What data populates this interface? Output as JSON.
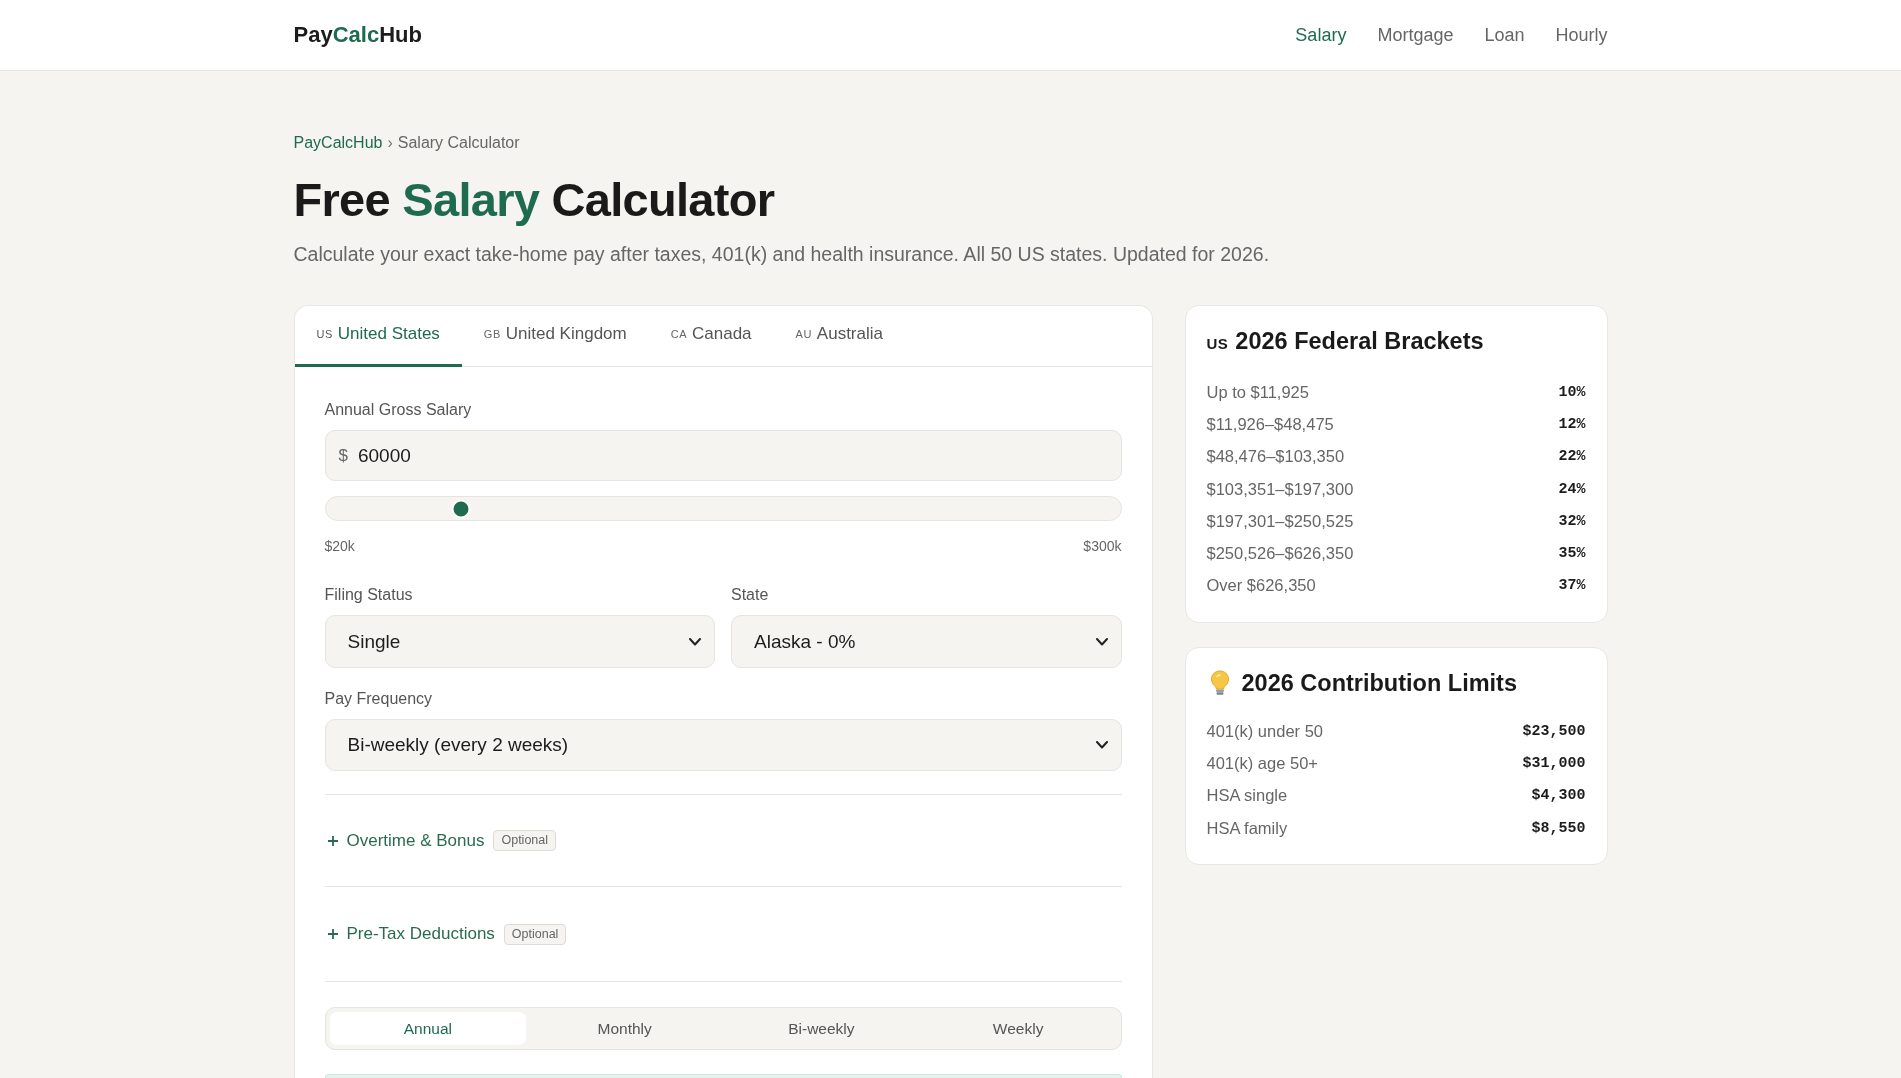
{
  "header": {
    "logo": [
      {
        "text": "Pay",
        "accent": false
      },
      {
        "text": "Calc",
        "accent": true
      },
      {
        "text": "Hub",
        "accent": false
      }
    ],
    "nav": [
      {
        "label": "Salary",
        "selected": true
      },
      {
        "label": "Mortgage",
        "selected": false
      },
      {
        "label": "Loan",
        "selected": false
      },
      {
        "label": "Hourly",
        "selected": false
      }
    ]
  },
  "breadcrumb": {
    "items": [
      {
        "text": "PayCalcHub",
        "kind": "link"
      },
      {
        "text": "Salary Calculator",
        "kind": "current"
      }
    ],
    "separator": "›"
  },
  "title": [
    {
      "text": "Free ",
      "accent": false
    },
    {
      "text": "Salary",
      "accent": true
    },
    {
      "text": " Calculator",
      "accent": false
    }
  ],
  "subtitle": "Calculate your exact take-home pay after taxes, 401(k) and health insurance. All 50 US states. Updated for 2026.",
  "calculator": {
    "tabs": [
      {
        "flag": "US",
        "label": "United States",
        "selected": true
      },
      {
        "flag": "GB",
        "label": "United Kingdom",
        "selected": false
      },
      {
        "flag": "CA",
        "label": "Canada",
        "selected": false
      },
      {
        "flag": "AU",
        "label": "Australia",
        "selected": false
      }
    ],
    "salary": {
      "label": "Annual Gross Salary",
      "prefix": "$",
      "value": "60000",
      "slider": {
        "level": 0.17
      },
      "min_label": "$20k",
      "max_label": "$300k"
    },
    "filing_status": {
      "label": "Filing Status",
      "value": "Single"
    },
    "state": {
      "label": "State",
      "value": "Alaska - 0%"
    },
    "pay_frequency": {
      "label": "Pay Frequency",
      "value": "Bi-weekly (every 2 weeks)"
    },
    "sections": [
      {
        "title": "Overtime & Bonus",
        "badge": "Optional",
        "expanded": false
      },
      {
        "title": "Pre-Tax Deductions",
        "badge": "Optional",
        "expanded": false
      }
    ],
    "periods": [
      {
        "label": "Annual",
        "selected": true
      },
      {
        "label": "Monthly",
        "selected": false
      },
      {
        "label": "Bi-weekly",
        "selected": false
      },
      {
        "label": "Weekly",
        "selected": false
      }
    ]
  },
  "brackets_card": {
    "flag": "US",
    "title": "2026 Federal Brackets",
    "rows": [
      {
        "range": "Up to $11,925",
        "rate": "10%"
      },
      {
        "range": "$11,926–$48,475",
        "rate": "12%"
      },
      {
        "range": "$48,476–$103,350",
        "rate": "22%"
      },
      {
        "range": "$103,351–$197,300",
        "rate": "24%"
      },
      {
        "range": "$197,301–$250,525",
        "rate": "32%"
      },
      {
        "range": "$250,526–$626,350",
        "rate": "35%"
      },
      {
        "range": "Over $626,350",
        "rate": "37%"
      }
    ]
  },
  "limits_card": {
    "title": "2026 Contribution Limits",
    "rows": [
      {
        "label": "401(k) under 50",
        "value": "$23,500"
      },
      {
        "label": "401(k) age 50+",
        "value": "$31,000"
      },
      {
        "label": "HSA single",
        "value": "$4,300"
      },
      {
        "label": "HSA family",
        "value": "$8,550"
      }
    ]
  }
}
